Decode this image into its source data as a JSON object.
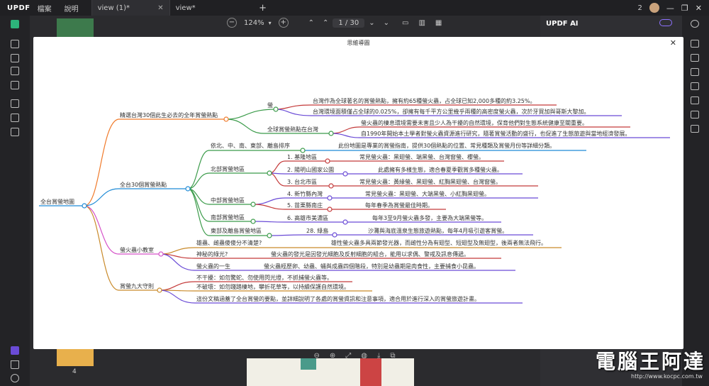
{
  "app": {
    "name": "UPDF",
    "menus": [
      "檔案",
      "說明"
    ]
  },
  "tabs": [
    {
      "label": "view (1)*"
    },
    {
      "label": "view*"
    }
  ],
  "titlebar_right": {
    "count": "2"
  },
  "toolbar": {
    "zoom": "124%",
    "page": "1 / 30"
  },
  "ai_panel": {
    "title": "UPDF AI"
  },
  "thumbnails": {
    "page_label": "4"
  },
  "dialog": {
    "title": "思維導圖"
  },
  "mindmap": {
    "root": "全台賞螢地圖",
    "b1": {
      "label": "精選台灣30個此生必去的全年賞螢熱點",
      "n1": {
        "label": "螢",
        "t1": "台灣作為全球著名的賞螢熱點，擁有約65種螢火蟲，占全球已知2,000多種的約3.25%。",
        "t2": "台灣環境面積僅占全球的0.025%，卻擁有每千平方公里幾乎兩種的高密度螢火蟲，次於牙買加與哥斯大黎加。"
      },
      "n2": {
        "label": "全球賞螢熱點在台灣",
        "t1": "螢火蟲的棲息環境需要未害且少人為干擾的自然環境，保育他們對生態系統健康至關重要。",
        "t2": "自1990年開始本土學者對螢火蟲資源進行研究，隨著賞螢活動的盛行，也促進了生態旅遊與當地經濟發展。"
      }
    },
    "b2": {
      "label": "全台30個賞螢熱點",
      "n0": {
        "label": "依北、中、南、東部、離島排序",
        "t": "此份地圖是專業的賞螢指南，提供30個熱點的位置、常見種類及賞螢月份等詳細分類。"
      },
      "north": {
        "label": "北部賞螢地區",
        "items": [
          {
            "label": "1. 基隆地區",
            "t": "常見螢火蟲：黑翅螢、端黑螢、台灣窗螢、櫻螢。"
          },
          {
            "label": "2. 陽明山國家公園",
            "t": "此處擁有多樣生態，適合春夏季觀賞多種螢火蟲。"
          },
          {
            "label": "3. 台北市區",
            "t": "常見螢火蟲：黃緣螢、黑翅螢、紅胸黑翅螢、台灣窗螢。"
          }
        ]
      },
      "central": {
        "label": "中部賞螢地區",
        "items": [
          {
            "label": "4. 新竹縣內灣",
            "t": "常見螢火蟲：黑翅螢、大端黑螢、小紅胸黑翅螢。"
          },
          {
            "label": "5. 苗栗縣南庄",
            "t": "每年春季為賞螢最佳時期。"
          }
        ]
      },
      "south": {
        "label": "南部賞螢地區",
        "items": [
          {
            "label": "6. 高雄市美濃區",
            "t": "每年3至9月螢火蟲多發，主要為大端黑螢等。"
          }
        ]
      },
      "east": {
        "label": "東部及離島賞螢地區",
        "items": [
          {
            "label": "28. 綠島",
            "t": "沙灘與海底溫泉生態旅遊熱點，每年4月吸引遊客賞螢。"
          }
        ]
      }
    },
    "b3": {
      "label": "螢火蟲小教室",
      "n1": {
        "label": "雄蟲、雌蟲傻傻分不清楚?",
        "t": "雄性螢火蟲多具兩節發光器，而雌性分為有翅型、短翅型及無翅型，後兩者無法飛行。"
      },
      "n2": {
        "label": "神秘的綠光?",
        "t": "螢火蟲的發光是因發光細胞及反射細胞的組合，能用以求偶、警戒及訊息傳遞。"
      },
      "n3": {
        "label": "螢火蟲的一生",
        "t": "螢火蟲經歷卵、幼蟲、蛹與成蟲四個階段，特別是幼蟲期是肉食性，主要捕食小昆蟲。"
      }
    },
    "b4": {
      "label": "賞螢九大守則",
      "r1": "不干擾：如勿驚蛇、勿使用閃光燈，不抓捕螢火蟲等。",
      "r2": "不破壞：如勿踐踏棲地，攀折花草等，以持續保護自然環境。",
      "r3": "這份文稿涵蓋了全台賞螢的要點，並詳細說明了各處的賞螢資訊和注意事項，適合用於進行深入的賞螢旅遊計畫。"
    }
  },
  "watermark": {
    "text": "電腦王阿達",
    "url": "http://www.kocpc.com.tw"
  },
  "colors": {
    "b1": "#f07a2a",
    "b2": "#1f8bd6",
    "b3": "#d552c8",
    "b4": "#c98a2a",
    "accent": "#8e72ff"
  }
}
